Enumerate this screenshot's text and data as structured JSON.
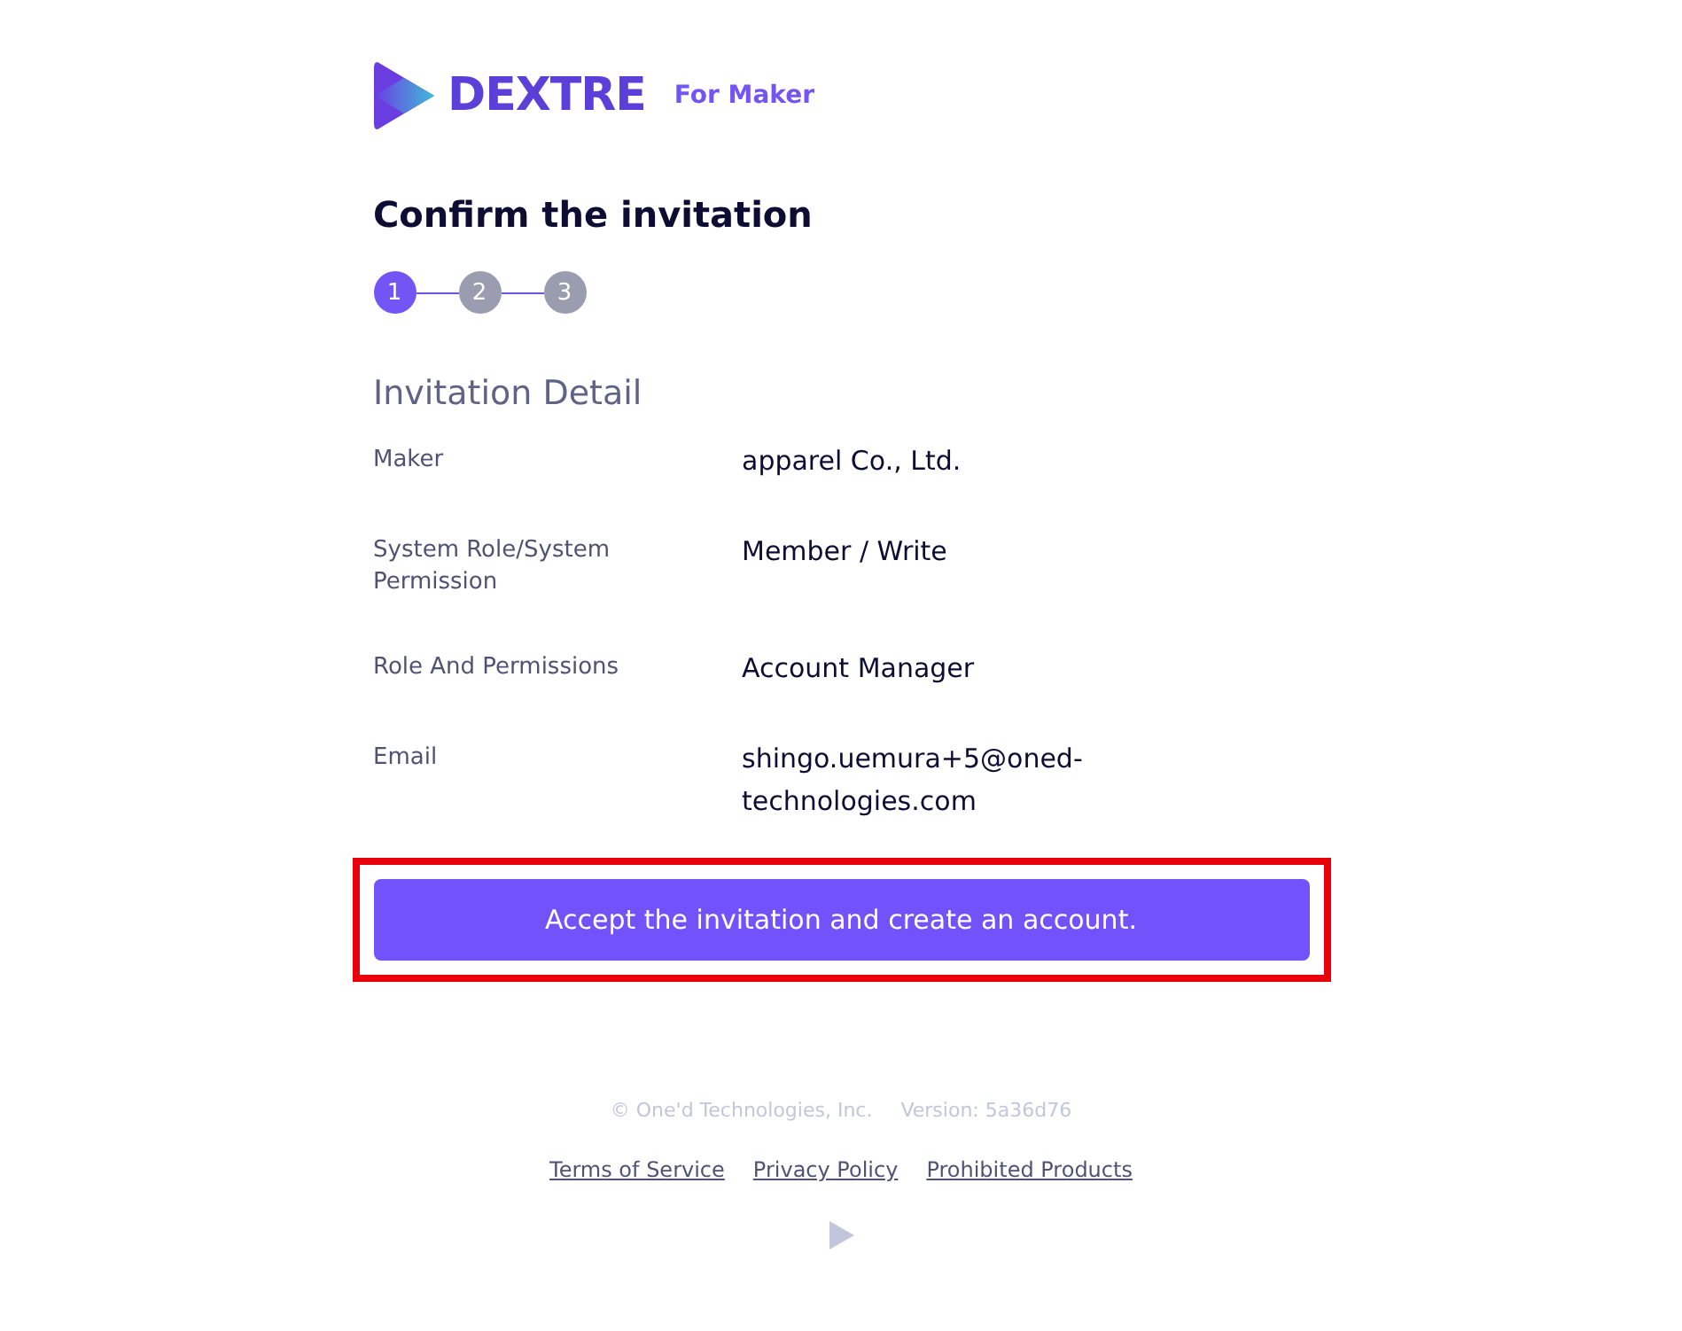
{
  "brand": {
    "name": "DEXTRE",
    "tag": "For Maker"
  },
  "title": "Confirm the invitation",
  "steps": [
    {
      "label": "1",
      "selected": true
    },
    {
      "label": "2",
      "selected": false
    },
    {
      "label": "3",
      "selected": false
    }
  ],
  "section_title": "Invitation Detail",
  "details": [
    {
      "label": "Maker",
      "value": "apparel Co., Ltd."
    },
    {
      "label": "System Role/System Permission",
      "value": "Member / Write"
    },
    {
      "label": "Role And Permissions",
      "value": "Account Manager"
    },
    {
      "label": "Email",
      "value": "shingo.uemura+5@oned-technologies.com"
    }
  ],
  "accept_button": {
    "label": "Accept the invitation and create an account.",
    "highlighted": true
  },
  "footer": {
    "copyright": "© One'd Technologies, Inc.",
    "version": "Version: 5a36d76",
    "links": [
      "Terms of Service",
      "Privacy Policy",
      "Prohibited Products"
    ]
  }
}
